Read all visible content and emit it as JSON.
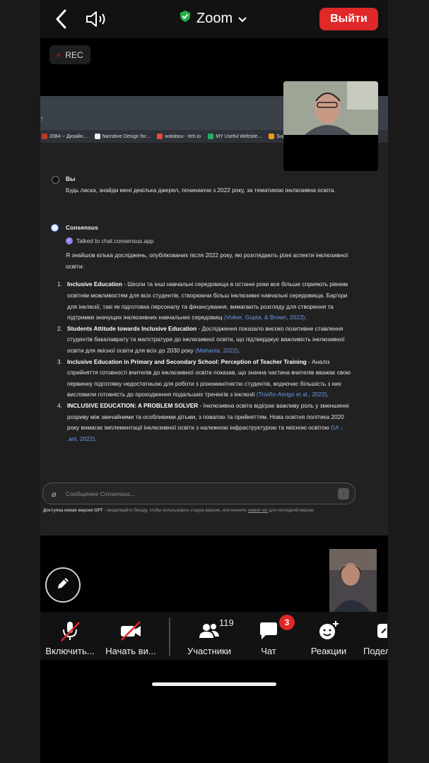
{
  "topbar": {
    "app_title": "Zoom",
    "leave_label": "Выйти"
  },
  "recording": {
    "label": "REC"
  },
  "browser": {
    "address_fragment": "7",
    "bookmarks": [
      "2084 -- Дизайн...",
      "Narrative Design for...",
      "watabou - itch.io",
      "MY Useful Website...",
      "Super"
    ]
  },
  "chat": {
    "user": {
      "name": "Вы",
      "text": "Будь ласка, знайди мені декілька джерел, починаючи з 2022 року, за тематикою інклюзивна освіта."
    },
    "bot": {
      "name": "Consensus",
      "talked": "Talked to chat.consensus.app",
      "intro": "Я знайшов кілька досліджень, опублікованих після 2022 року, які розглядають різні аспекти інклюзивної освіти:",
      "items": [
        {
          "num": "1.",
          "title": "Inclusive Education",
          "text": " - Школи та інші навчальні середовища в останні роки все більше сприяють рівним освітнім можливостям для всіх студентів, створюючи більш інклюзивні навчальні середовища. Бар'єри для інклюзії, такі як підготовка персоналу та фінансування, вимагають розгляду для створення та підтримки значущих інклюзивних навчальних середовищ ",
          "cite": "(Volker, Gupta, & Brown, 2023)",
          "end": "."
        },
        {
          "num": "2.",
          "title": "Students Attitude towards Inclusive Education",
          "text": " - Дослідження показало високо позитивне ставлення студентів бакалаврату та магістратури до інклюзивної освіти, що підтверджує важливість інклюзивної освіти для якісної освіти для всіх до 2030 року ",
          "cite": "(Mahanta, 2022)",
          "end": "."
        },
        {
          "num": "3.",
          "title": "Inclusive Education in Primary and Secondary School: Perception of Teacher Training",
          "text": " - Аналіз сприйняття готовності вчителів до інклюзивної освіти показав, що значна частина вчителів вважає свою первинну підготовку недостатньою для роботи з різноманітністю студентів, водночас більшість з них висловили готовність до проходження подальших тренінгів з інклюзії ",
          "cite": "(Triviño-Amigo et al., 2022)",
          "end": "."
        },
        {
          "num": "4.",
          "title": "INCLUSIVE EDUCATION: A PROBLEM SOLVER",
          "text": " - Інклюзивна освіта відіграє важливу роль у зменшенні розриву між звичайними та особливими дітьми, з повагою та прийняттям. Нова освітня політика 2020 року вимагає імплементації інклюзивної освіти з належною інфраструктурою та якісною освітою ",
          "cite": "(Ut  ↓  ,ani, 2022)",
          "end": "."
        }
      ]
    },
    "input_placeholder": "Сообщение Consensus...",
    "footer_note_prefix": "Доступна новая версия GPT",
    "footer_note_rest": " - продолжайте беседу, чтобы использовать старую версию, или начните ",
    "footer_note_link": "новый чат",
    "footer_note_end": " для последней версии."
  },
  "toolbar": {
    "mic_label": "Включить...",
    "video_label": "Начать ви...",
    "participants_label": "Участники",
    "participants_count": "119",
    "chat_label": "Чат",
    "chat_badge": "3",
    "reactions_label": "Реакции",
    "share_label": "Подел"
  },
  "icons": [
    "chevron-left-icon",
    "speaker-icon",
    "shield-check-icon",
    "chevron-down-icon",
    "pen-icon",
    "mic-off-icon",
    "video-off-icon",
    "participants-icon",
    "chat-icon",
    "reaction-icon",
    "share-icon",
    "paperclip-icon",
    "arrow-up-icon"
  ],
  "colors": {
    "accent_red": "#e02828",
    "shield_green": "#21b24b",
    "link_blue": "#6a9bea",
    "check_purple": "#9a7df2"
  }
}
